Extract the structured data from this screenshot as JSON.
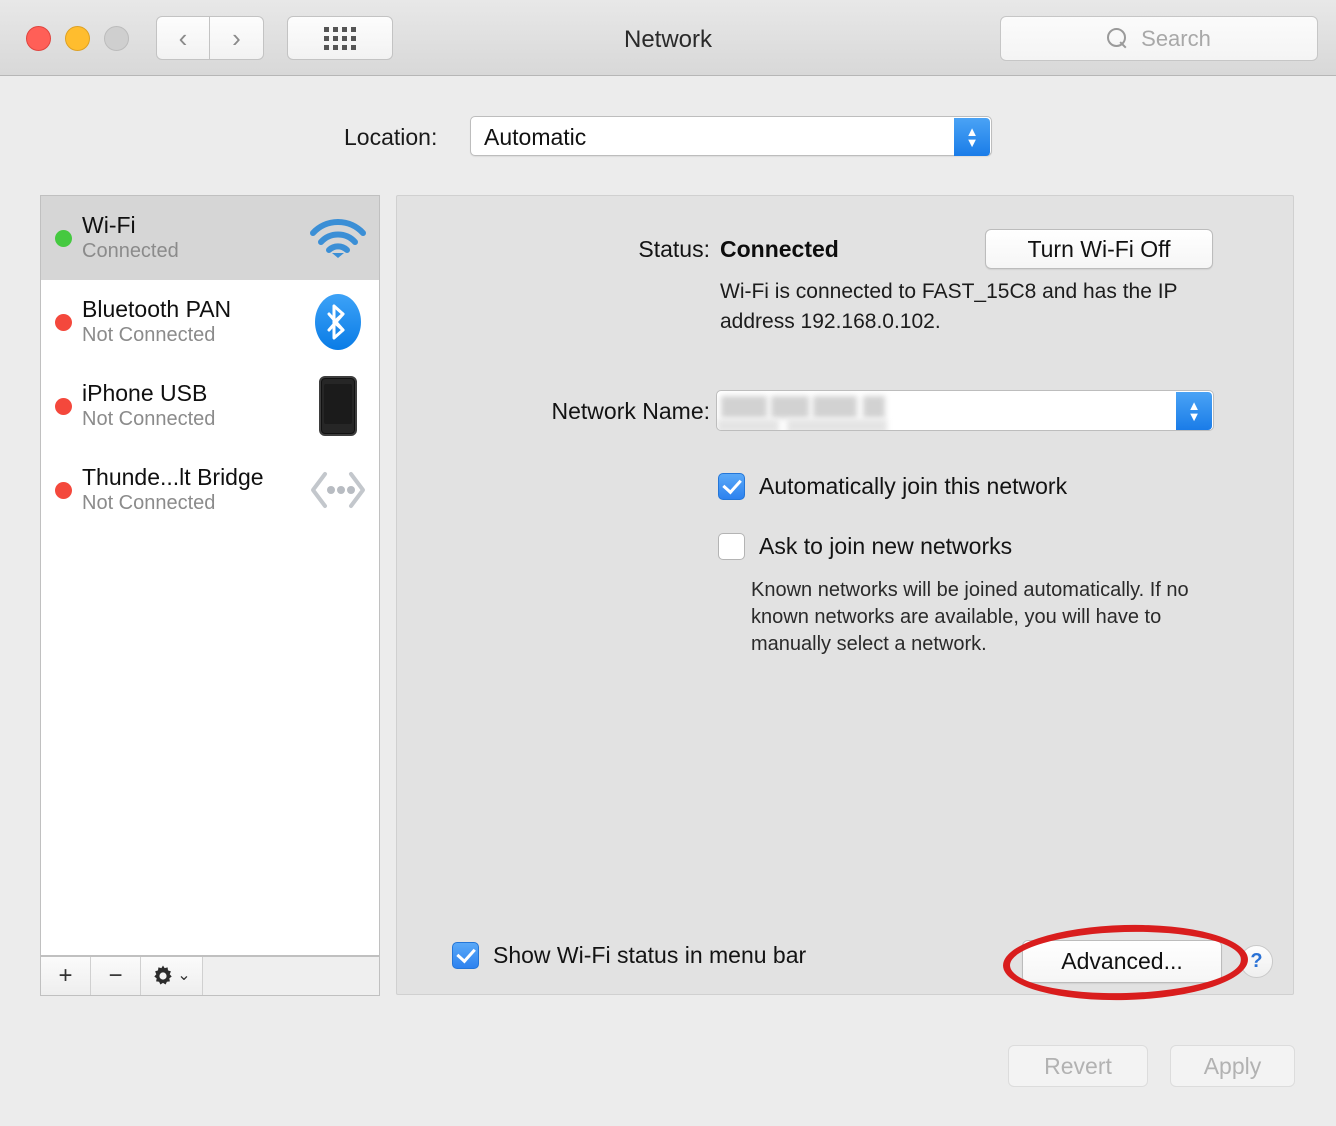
{
  "window": {
    "title": "Network",
    "traffic_lights": [
      "close",
      "minimize",
      "zoom"
    ],
    "back_glyph": "‹",
    "forward_glyph": "›",
    "grid_icon": "grid-icon",
    "search_placeholder": "Search",
    "search_icon": "search-icon"
  },
  "location": {
    "label": "Location:",
    "value": "Automatic",
    "stepper_up": "▲",
    "stepper_down": "▼"
  },
  "sidebar": {
    "services": [
      {
        "name": "Wi-Fi",
        "state": "Connected",
        "status_color": "#45c940",
        "icon": "wifi-icon",
        "selected": true
      },
      {
        "name": "Bluetooth PAN",
        "state": "Not Connected",
        "status_color": "#f4483c",
        "icon": "bluetooth-icon",
        "selected": false
      },
      {
        "name": "iPhone USB",
        "state": "Not Connected",
        "status_color": "#f4483c",
        "icon": "iphone-icon",
        "selected": false
      },
      {
        "name": "Thunde...lt Bridge",
        "state": "Not Connected",
        "status_color": "#f4483c",
        "icon": "thunderbolt-bridge-icon",
        "selected": false
      }
    ],
    "toolbar": {
      "add_label": "+",
      "remove_label": "−",
      "gear_label": "gear-icon",
      "gear_chevron": "⌄"
    }
  },
  "main": {
    "status_label": "Status:",
    "status_value": "Connected",
    "turn_off_button": "Turn Wi-Fi Off",
    "status_description": "Wi-Fi is connected to FAST_15C8 and has the IP address 192.168.0.102.",
    "network_name_label": "Network Name:",
    "network_name_value": "",
    "checkbox_auto_join": {
      "label": "Automatically join this network",
      "checked": true
    },
    "checkbox_ask_join": {
      "label": "Ask to join new networks",
      "checked": false
    },
    "ask_join_description": "Known networks will be joined automatically. If no known networks are available, you will have to manually select a network.",
    "checkbox_menu_bar": {
      "label": "Show Wi-Fi status in menu bar",
      "checked": true
    },
    "advanced_button": "Advanced...",
    "help_button": "?"
  },
  "footer": {
    "revert_button": "Revert",
    "revert_disabled": true,
    "apply_button": "Apply",
    "apply_disabled": true
  },
  "annotation": {
    "shape": "ellipse-highlight",
    "color": "#d91d1d",
    "target": "Advanced..."
  }
}
